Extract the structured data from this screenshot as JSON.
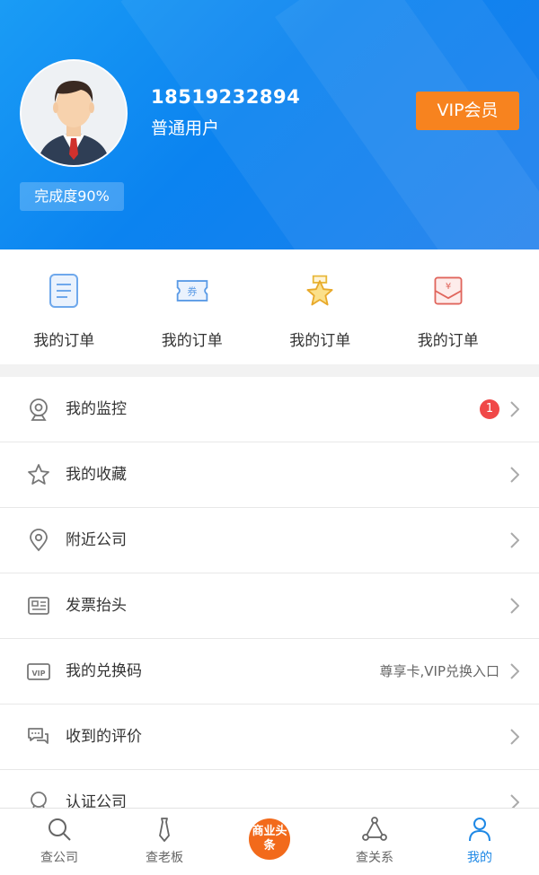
{
  "header": {
    "phone": "18519232894",
    "user_type": "普通用户",
    "vip_label": "VIP会员",
    "completion": "完成度90%"
  },
  "orders": [
    {
      "label": "我的订单",
      "icon": "document-icon"
    },
    {
      "label": "我的订单",
      "icon": "coupon-icon"
    },
    {
      "label": "我的订单",
      "icon": "star-badge-icon"
    },
    {
      "label": "我的订单",
      "icon": "red-envelope-icon"
    }
  ],
  "menu": [
    {
      "label": "我的监控",
      "icon": "webcam-icon",
      "badge": "1"
    },
    {
      "label": "我的收藏",
      "icon": "star-icon"
    },
    {
      "label": "附近公司",
      "icon": "location-icon"
    },
    {
      "label": "发票抬头",
      "icon": "invoice-icon"
    },
    {
      "label": "我的兑换码",
      "icon": "vip-card-icon",
      "extra": "尊享卡,VIP兑换入口"
    },
    {
      "label": "收到的评价",
      "icon": "comment-icon"
    },
    {
      "label": "认证公司",
      "icon": "certification-icon"
    }
  ],
  "tabs": [
    {
      "label": "查公司",
      "icon": "search-icon"
    },
    {
      "label": "查老板",
      "icon": "tie-icon"
    },
    {
      "label": "商业头条",
      "icon": "business-news-icon"
    },
    {
      "label": "查关系",
      "icon": "network-icon"
    },
    {
      "label": "我的",
      "icon": "user-icon",
      "active": true
    }
  ],
  "colors": {
    "header_blue": "#0b83f0",
    "vip_orange": "#f7831f",
    "badge_red": "#f04848",
    "active_blue": "#1e88e5"
  }
}
